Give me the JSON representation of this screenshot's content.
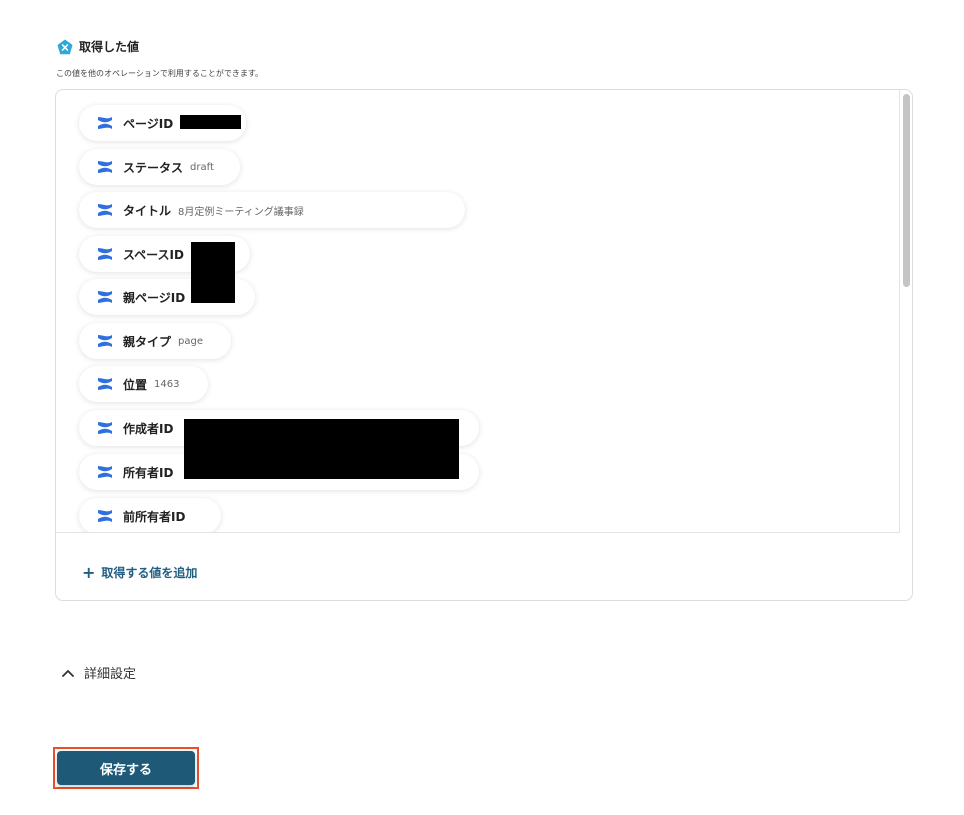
{
  "header": {
    "title": "取得した値",
    "description": "この値を他のオペレーションで利用することができます。",
    "icon": "pentagon-x-icon"
  },
  "fields": [
    {
      "label": "ページID",
      "value": ""
    },
    {
      "label": "ステータス",
      "value": "draft"
    },
    {
      "label": "タイトル",
      "value": "8月定例ミーティング議事録"
    },
    {
      "label": "スペースID",
      "value": ""
    },
    {
      "label": "親ページID",
      "value": ""
    },
    {
      "label": "親タイプ",
      "value": "page"
    },
    {
      "label": "位置",
      "value": "1463"
    },
    {
      "label": "作成者ID",
      "value": ""
    },
    {
      "label": "所有者ID",
      "value": ""
    },
    {
      "label": "前所有者ID",
      "value": ""
    }
  ],
  "add_action": {
    "icon": "plus-icon",
    "label": "取得する値を追加"
  },
  "details": {
    "icon": "chevron-up-icon",
    "label": "詳細設定"
  },
  "save_button": {
    "label": "保存する"
  },
  "colors": {
    "accent": "#1e5a78",
    "link": "#1f5f82",
    "field_icon": "#2f6fe0",
    "highlight_border": "#e8502c"
  }
}
